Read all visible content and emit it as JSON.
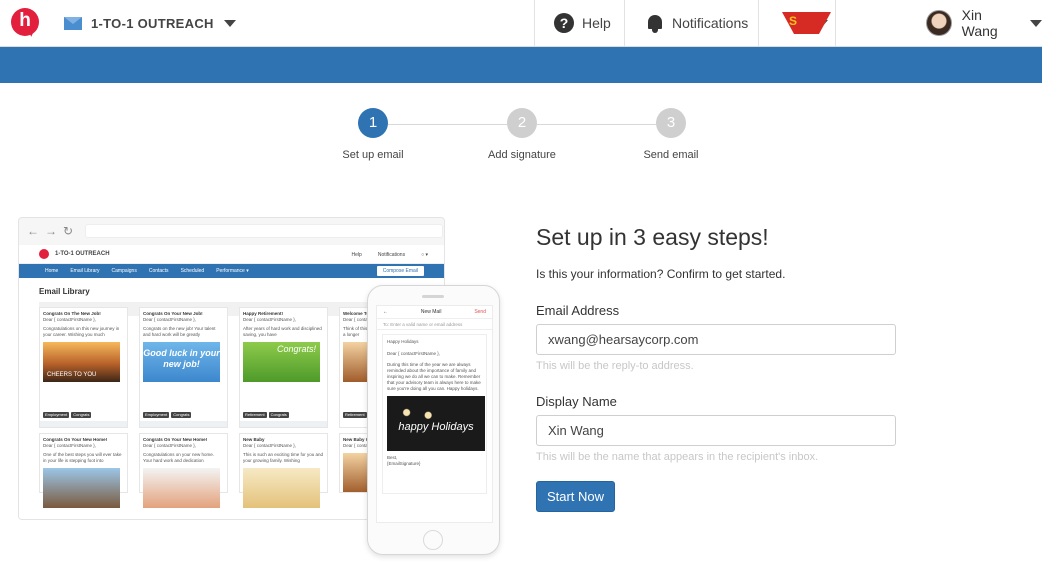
{
  "header": {
    "logo_letter": "h",
    "product_name": "1-TO-1 OUTREACH",
    "help_label": "Help",
    "notifications_label": "Notifications",
    "user_name": "Xin Wang"
  },
  "colors": {
    "brand_red": "#e21f3d",
    "accent_blue": "#2f73b3",
    "inactive_step": "#cfcfcf"
  },
  "stepper": {
    "steps": [
      {
        "number": "1",
        "label": "Set up email",
        "active": true
      },
      {
        "number": "2",
        "label": "Add signature",
        "active": false
      },
      {
        "number": "3",
        "label": "Send email",
        "active": false
      }
    ]
  },
  "preview": {
    "product_name": "1-TO-1 OUTREACH",
    "help_label": "Help",
    "notifications_label": "Notifications",
    "nav_items": [
      "Home",
      "Email Library",
      "Campaigns",
      "Contacts",
      "Scheduled",
      "Performance ▾"
    ],
    "compose_label": "Compose Email",
    "library_title": "Email Library",
    "cards": [
      {
        "title": "Congrats On The New Job!",
        "greeting": "Dear { contactFirstName },",
        "body": "Congratulations on this new journey in your career. Wishing you much",
        "image_text": "CHEERS TO YOU",
        "tags": [
          "Employment",
          "Congrats"
        ]
      },
      {
        "title": "Congrats On Your New Job!",
        "greeting": "Dear { contactFirstName },",
        "body": "Congrats on the new job! Your talent and hard work will be greatly",
        "image_text": "Good luck in your new job!",
        "tags": [
          "Employment",
          "Congrats"
        ]
      },
      {
        "title": "Happy Retirement!",
        "greeting": "Dear { contactFirstName },",
        "body": "After years of hard work and disciplined saving, you have",
        "image_text": "Congrats!",
        "tags": [
          "Retirement",
          "Congrats"
        ]
      },
      {
        "title": "Welcome To",
        "greeting": "Dear { conta",
        "body": "Think of this as a longer",
        "image_text": "",
        "tags": [
          "Retirement"
        ]
      },
      {
        "title": "Congrats On Your New Home!",
        "greeting": "Dear { contactFirstName },",
        "body": "One of the best steps you will ever take in your life is stepping foot into",
        "image_text": "",
        "tags": []
      },
      {
        "title": "Congrats On Your New Home!",
        "greeting": "Dear { contactFirstName },",
        "body": "Congratulations on your new home. Your hard work and dedication",
        "image_text": "",
        "tags": []
      },
      {
        "title": "New Baby",
        "greeting": "Dear { contactFirstName },",
        "body": "This is such an exciting time for you and your growing family. Wishing",
        "image_text": "",
        "tags": []
      },
      {
        "title": "New Baby G",
        "greeting": "Dear { conta",
        "body": "",
        "image_text": "",
        "tags": []
      }
    ],
    "phone": {
      "header_title": "New Mail",
      "send_label": "Send",
      "to_label": "To:",
      "to_placeholder": "Enter a valid name or email address",
      "subject": "Happy Holidays",
      "greeting": "Dear { contactFirstName },",
      "body": "During this time of the year we are always reminded about the importance of family and inspiring we do all we can to make. Remember that your advisory team is always here to make sure you're doing all you can. Happy holidays.",
      "image_text": "happy Holidays",
      "signoff": "Best,",
      "signature": "{EmailSignature}"
    }
  },
  "form": {
    "title": "Set up in 3 easy steps!",
    "subtitle": "Is this your information? Confirm to get started.",
    "email_label": "Email Address",
    "email_value": "xwang@hearsaycorp.com",
    "email_help": "This will be the reply-to address.",
    "name_label": "Display Name",
    "name_value": "Xin Wang",
    "name_help": "This will be the name that appears in the recipient's inbox.",
    "start_button": "Start Now"
  }
}
